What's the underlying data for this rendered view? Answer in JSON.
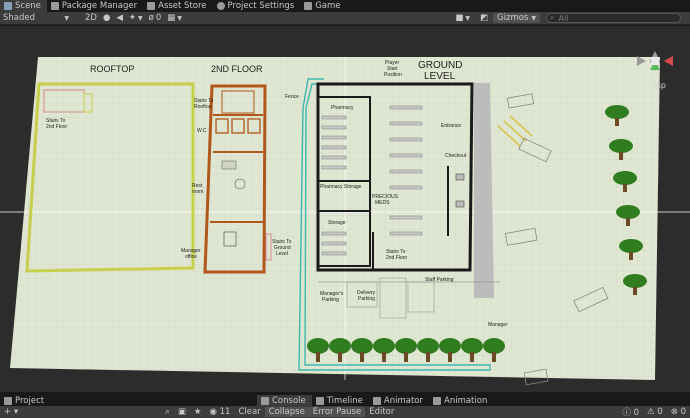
{
  "tabs": [
    {
      "label": "Scene",
      "icon": "scene-icon"
    },
    {
      "label": "Package Manager",
      "icon": "package-icon"
    },
    {
      "label": "Asset Store",
      "icon": "store-icon"
    },
    {
      "label": "Project Settings",
      "icon": "gear-icon"
    },
    {
      "label": "Game",
      "icon": "gamepad-icon"
    }
  ],
  "toolbar": {
    "shading_mode": "Shaded",
    "mode_2d": "2D",
    "hidden_count": "0",
    "gizmos": "Gizmos",
    "search_placeholder": "All"
  },
  "scene": {
    "gizmo_label": "rsp",
    "labels": {
      "rooftop": "ROOFTOP",
      "second_floor": "2ND FLOOR",
      "ground": "GROUND",
      "level": "LEVEL",
      "stairs_2nd_1": "Stairs To",
      "stairs_2nd_2": "2nd Floor",
      "stairs_roof_1": "Stairs To",
      "stairs_roof_2": "Rooftop",
      "wc": "W.C",
      "rest_1": "Rest",
      "rest_2": "room",
      "manager_office_1": "Manager",
      "manager_office_2": "office",
      "stairs_ground_1": "Stairs To",
      "stairs_ground_2": "Ground",
      "stairs_ground_3": "Level",
      "fence": "Fence",
      "player_1": "Player",
      "player_2": "Start",
      "player_3": "Position",
      "pharmacy": "Pharmacy",
      "pharmacy_storage": "Pharmacy Storage",
      "precious_1": "PRECIOUS",
      "precious_2": "MEDS",
      "storage": "Storage",
      "stairs_g2_1": "Stairs To",
      "stairs_g2_2": "2nd Floor",
      "entrance": "Entrance",
      "checkout": "Checkout",
      "staff_parking": "Staff Parking",
      "managers_parking_1": "Manager's",
      "managers_parking_2": "Parking",
      "delivery_1": "Delivery",
      "delivery_2": "Parking",
      "manager": "Manager"
    }
  },
  "bottom_tabs": [
    {
      "label": "Project",
      "icon": "folder-icon"
    },
    {
      "label": "Console",
      "icon": "console-icon"
    },
    {
      "label": "Timeline",
      "icon": "timeline-icon"
    },
    {
      "label": "Animator",
      "icon": "animator-icon"
    },
    {
      "label": "Animation",
      "icon": "animation-icon"
    }
  ],
  "console": {
    "count": "11",
    "clear": "Clear",
    "collapse": "Collapse",
    "error_pause": "Error Pause",
    "editor": "Editor",
    "log_count": "0",
    "warn_count": "0",
    "error_count": "0"
  },
  "colors": {
    "rooftop_wall": "#c8cf4a",
    "floor2_wall": "#b0571c",
    "ground_wall": "#1a1a1a",
    "fence": "#3fb7b0",
    "tree": "#2f7d1f",
    "ground_plane": "#dfe6d1"
  }
}
